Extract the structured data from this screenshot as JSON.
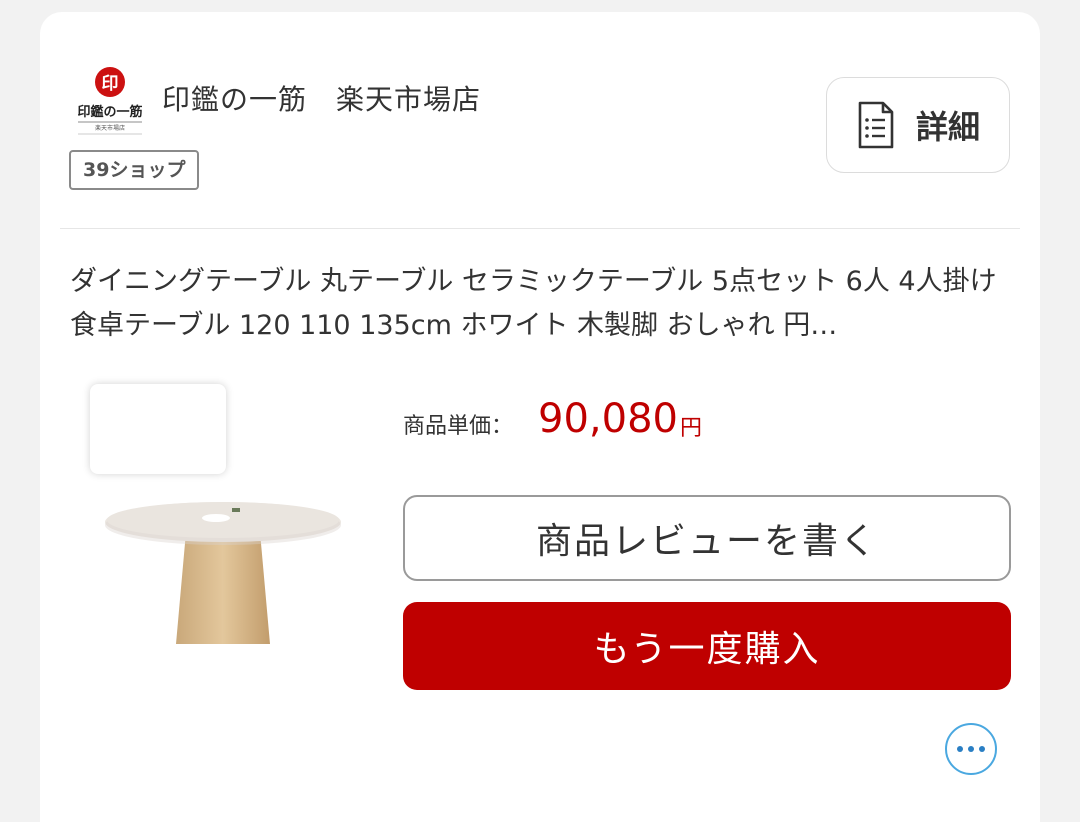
{
  "shop": {
    "name": "印鑑の一筋　楽天市場店",
    "badge": "39ショップ",
    "logo_text": "印鑑の一筋",
    "logo_sub": "楽天市場店"
  },
  "details_button": {
    "label": "詳細",
    "icon": "document-list-icon"
  },
  "product": {
    "title": "ダイニングテーブル 丸テーブル セラミックテーブル 5点セット 6人 4人掛け 食卓テーブル 120 110 135cm ホワイト 木製脚 おしゃれ 円…",
    "price_label": "商品単価：",
    "price_value": "90,080",
    "price_unit": "円"
  },
  "actions": {
    "review_label": "商品レビューを書く",
    "rebuy_label": "もう一度購入",
    "more_icon": "more-dots-icon"
  },
  "colors": {
    "accent": "#bf0000",
    "more_border": "#4aa8e0",
    "background": "#f2f2f2"
  }
}
